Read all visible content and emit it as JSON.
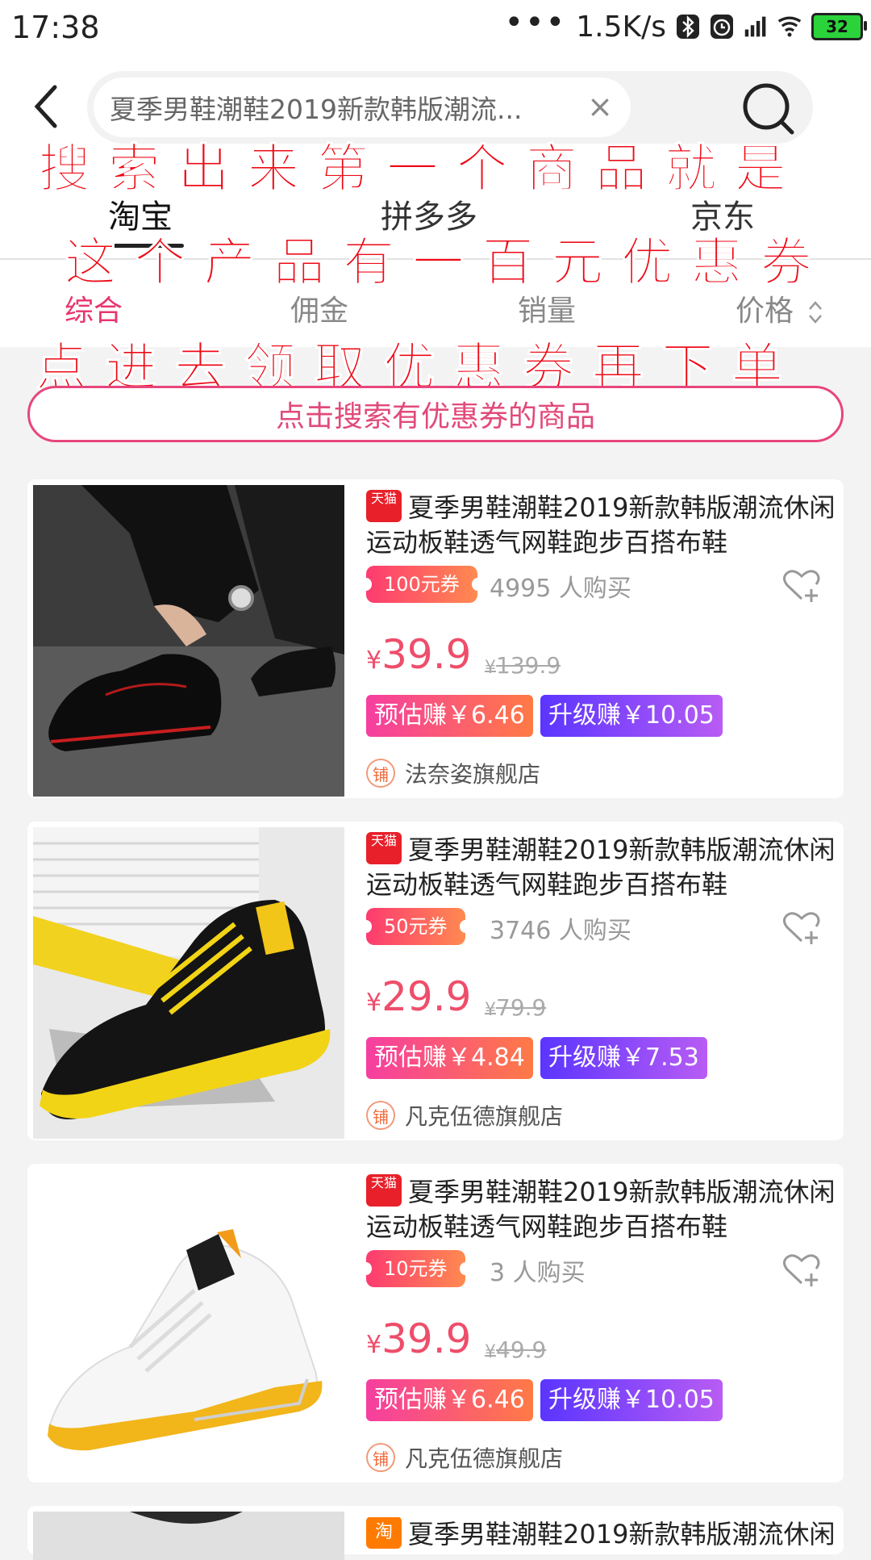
{
  "status_bar": {
    "time": "17:38",
    "dots": "•••",
    "net_speed": "1.5K/s",
    "battery": "32"
  },
  "search": {
    "query": "夏季男鞋潮鞋2019新款韩版潮流...",
    "clear": "×"
  },
  "platform_tabs": [
    {
      "label": "淘宝"
    },
    {
      "label": "拼多多"
    },
    {
      "label": "京东"
    }
  ],
  "sort_tabs": [
    {
      "label": "综合"
    },
    {
      "label": "佣金"
    },
    {
      "label": "销量"
    },
    {
      "label": "价格"
    }
  ],
  "overlay_text": [
    "搜 索 出 来 第 一 个 商 品 就 是",
    "这 个 产 品 有 一 百 元 优 惠 券",
    "点 进 去 领 取 优 惠 券 再 下 单"
  ],
  "coupon_search_label": "点击搜索有优惠券的商品",
  "products": [
    {
      "badge": "天猫",
      "title": "夏季男鞋潮鞋2019新款韩版潮流休闲运动板鞋透气网鞋跑步百搭布鞋",
      "coupon": "100元券",
      "buyers": "4995 人购买",
      "price_symbol": "¥",
      "price": "39.9",
      "orig_symbol": "¥",
      "orig_price": "139.9",
      "earn_est": "预估赚￥6.46",
      "earn_up": "升级赚￥10.05",
      "shop_icon": "铺",
      "shop": "法奈姿旗舰店"
    },
    {
      "badge": "天猫",
      "title": "夏季男鞋潮鞋2019新款韩版潮流休闲运动板鞋透气网鞋跑步百搭布鞋",
      "coupon": "50元券",
      "buyers": "3746 人购买",
      "price_symbol": "¥",
      "price": "29.9",
      "orig_symbol": "¥",
      "orig_price": "79.9",
      "earn_est": "预估赚￥4.84",
      "earn_up": "升级赚￥7.53",
      "shop_icon": "铺",
      "shop": "凡克伍德旗舰店"
    },
    {
      "badge": "天猫",
      "title": "夏季男鞋潮鞋2019新款韩版潮流休闲运动板鞋透气网鞋跑步百搭布鞋",
      "coupon": "10元券",
      "buyers": "3 人购买",
      "price_symbol": "¥",
      "price": "39.9",
      "orig_symbol": "¥",
      "orig_price": "49.9",
      "earn_est": "预估赚￥6.46",
      "earn_up": "升级赚￥10.05",
      "shop_icon": "铺",
      "shop": "凡克伍德旗舰店"
    },
    {
      "badge": "淘",
      "title": "夏季男鞋潮鞋2019新款韩版潮流休闲"
    }
  ],
  "colors": {
    "accent": "#e8356d",
    "overlay_red": "#ee0a16",
    "price": "#ee4e6b"
  }
}
